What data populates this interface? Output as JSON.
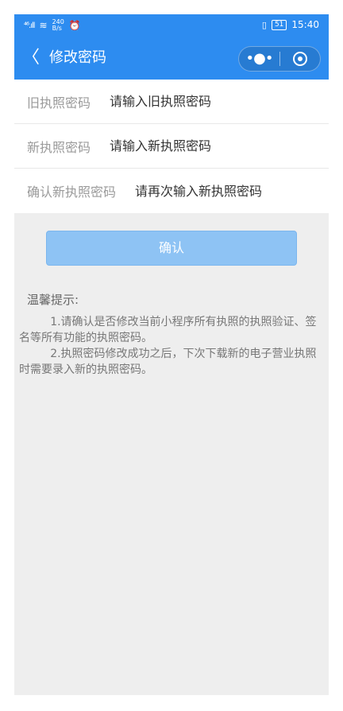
{
  "status_bar": {
    "signal": "⁴⁶.ıll",
    "wifi": "≋",
    "speed_value": "240",
    "speed_unit": "B/s",
    "alarm": "⏰",
    "vibrate": "▯",
    "battery": "51",
    "time": "15:40"
  },
  "nav": {
    "back_icon": "〈",
    "title": "修改密码",
    "more_icon": "•●•"
  },
  "form": {
    "fields": [
      {
        "label": "旧执照密码",
        "placeholder": "请输入旧执照密码"
      },
      {
        "label": "新执照密码",
        "placeholder": "请输入新执照密码"
      },
      {
        "label": "确认新执照密码",
        "placeholder": "请再次输入新执照密码"
      }
    ]
  },
  "confirm_label": "确认",
  "tips": {
    "title": "温馨提示:",
    "items": [
      "1.请确认是否修改当前小程序所有执照的执照验证、签名等所有功能的执照密码。",
      "2.执照密码修改成功之后，下次下载新的电子营业执照时需要录入新的执照密码。"
    ]
  },
  "colors": {
    "header_bg": "#2d8cf0",
    "button_bg": "#8ec3f4",
    "page_bg": "#eeeeee"
  }
}
